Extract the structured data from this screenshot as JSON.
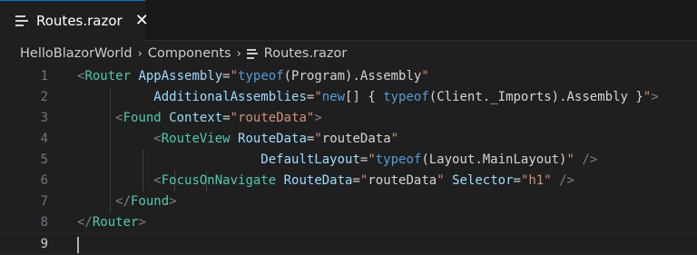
{
  "tab": {
    "label": "Routes.razor",
    "close": "✕",
    "icon": "file-lines-icon"
  },
  "breadcrumb": {
    "items": [
      "HelloBlazorWorld",
      "Components",
      "Routes.razor"
    ],
    "separator": "›"
  },
  "colors": {
    "background": "#1f1f1f",
    "tag": "#808080",
    "component": "#4ec9b0",
    "attribute": "#9cdcfe",
    "string": "#ce9178",
    "keyword": "#569cd6"
  },
  "editor": {
    "active_line": 9,
    "lines": [
      {
        "n": "1",
        "tokens": [
          [
            "t-tag",
            "<"
          ],
          [
            "t-name",
            "Router"
          ],
          [
            "t-code",
            " "
          ],
          [
            "t-attr",
            "AppAssembly"
          ],
          [
            "t-eq",
            "="
          ],
          [
            "t-str",
            "\""
          ],
          [
            "t-kw",
            "typeof"
          ],
          [
            "t-code",
            "(Program).Assembly"
          ],
          [
            "t-str",
            "\""
          ]
        ]
      },
      {
        "n": "2",
        "tokens": [
          [
            "t-code",
            "          "
          ],
          [
            "t-attr",
            "AdditionalAssemblies"
          ],
          [
            "t-eq",
            "="
          ],
          [
            "t-str",
            "\""
          ],
          [
            "t-kw",
            "new"
          ],
          [
            "t-code",
            "[] { "
          ],
          [
            "t-kw",
            "typeof"
          ],
          [
            "t-code",
            "(Client._Imports).Assembly }"
          ],
          [
            "t-str",
            "\""
          ],
          [
            "t-tag",
            ">"
          ]
        ]
      },
      {
        "n": "3",
        "tokens": [
          [
            "t-code",
            "     "
          ],
          [
            "t-tag",
            "<"
          ],
          [
            "t-name",
            "Found"
          ],
          [
            "t-code",
            " "
          ],
          [
            "t-attr",
            "Context"
          ],
          [
            "t-eq",
            "="
          ],
          [
            "t-str",
            "\"routeData\""
          ],
          [
            "t-tag",
            ">"
          ]
        ]
      },
      {
        "n": "4",
        "tokens": [
          [
            "t-code",
            "          "
          ],
          [
            "t-tag",
            "<"
          ],
          [
            "t-name",
            "RouteView"
          ],
          [
            "t-code",
            " "
          ],
          [
            "t-attr",
            "RouteData"
          ],
          [
            "t-eq",
            "="
          ],
          [
            "t-str",
            "\""
          ],
          [
            "t-code",
            "routeData"
          ],
          [
            "t-str",
            "\""
          ]
        ]
      },
      {
        "n": "5",
        "tokens": [
          [
            "t-code",
            "                        "
          ],
          [
            "t-attr",
            "DefaultLayout"
          ],
          [
            "t-eq",
            "="
          ],
          [
            "t-str",
            "\""
          ],
          [
            "t-kw",
            "typeof"
          ],
          [
            "t-code",
            "(Layout.MainLayout)"
          ],
          [
            "t-str",
            "\""
          ],
          [
            "t-code",
            " "
          ],
          [
            "t-tag",
            "/>"
          ]
        ]
      },
      {
        "n": "6",
        "tokens": [
          [
            "t-code",
            "          "
          ],
          [
            "t-tag",
            "<"
          ],
          [
            "t-name",
            "FocusOnNavigate"
          ],
          [
            "t-code",
            " "
          ],
          [
            "t-attr",
            "RouteData"
          ],
          [
            "t-eq",
            "="
          ],
          [
            "t-str",
            "\""
          ],
          [
            "t-code",
            "routeData"
          ],
          [
            "t-str",
            "\""
          ],
          [
            "t-code",
            " "
          ],
          [
            "t-attr",
            "Selector"
          ],
          [
            "t-eq",
            "="
          ],
          [
            "t-str",
            "\"h1\""
          ],
          [
            "t-code",
            " "
          ],
          [
            "t-tag",
            "/>"
          ]
        ]
      },
      {
        "n": "7",
        "tokens": [
          [
            "t-code",
            "     "
          ],
          [
            "t-tag",
            "</"
          ],
          [
            "t-name",
            "Found"
          ],
          [
            "t-tag",
            ">"
          ]
        ]
      },
      {
        "n": "8",
        "tokens": [
          [
            "t-tag",
            "</"
          ],
          [
            "t-name",
            "Router"
          ],
          [
            "t-tag",
            ">"
          ]
        ]
      },
      {
        "n": "9",
        "tokens": []
      }
    ]
  }
}
